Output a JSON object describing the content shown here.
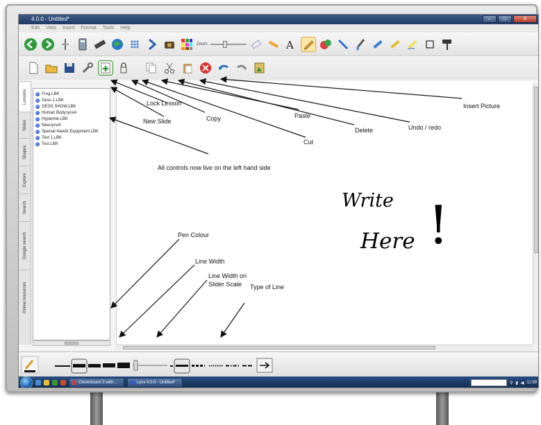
{
  "window": {
    "title": "4.0.0 - Untitled*",
    "controls": [
      "–",
      "□",
      "X"
    ]
  },
  "menu": [
    "Edit",
    "View",
    "Insert",
    "Format",
    "Tools",
    "Help"
  ],
  "toolbar_top": {
    "zoom_label": "Zoom:"
  },
  "sidebar_tabs": [
    "Lessons",
    "Slides",
    "Shapes",
    "Explore",
    "Search",
    "Google search",
    "Online resources"
  ],
  "files": [
    "Frog.LBK",
    "Gess 1.LBK",
    "GESS SHOW.LBK",
    "Human Body.lynx4",
    "Hyperlink.LBK",
    "New.lynx4",
    "Special Needs Equipment.LBK",
    "Test 1.LBK",
    "Test.LBK"
  ],
  "annotations": {
    "lock_lesson": "Lock Lesson",
    "new_slide": "New Slide",
    "copy": "Copy",
    "paste": "Paste",
    "cut": "Cut",
    "delete": "Delete",
    "undo_redo": "Undo / redo",
    "insert_picture": "Insert Picture",
    "left_controls": "All controls now live on the left hand side",
    "pen_colour": "Pen Colour",
    "line_width": "Line Width",
    "line_width_slider_1": "Line Width on",
    "line_width_slider_2": "Slider Scale",
    "type_of_line": "Type of Line"
  },
  "handwriting": {
    "line1": "Write",
    "line2": "Here",
    "mark": "!"
  },
  "taskbar": {
    "buttons": [
      "Cleverboard 3 with...",
      "Lynx 4.0.0 - Untitled*"
    ],
    "clock": "11:59"
  },
  "colors": {
    "titlebar": "#1e3a64",
    "taskbar": "#12284b",
    "canvas": "#ffffff"
  },
  "icons": {
    "toolbar_top": [
      "back-icon",
      "forward-icon",
      "pin-icon",
      "calculator-icon",
      "ruler-icon",
      "globe-icon",
      "grid-dots-icon",
      "next-arrow-icon",
      "camera-icon",
      "color-grid-icon",
      "zoom-slider",
      "eraser-icon",
      "highlighter-icon",
      "text-icon",
      "pen-icon",
      "shape-icon",
      "line-icon",
      "brush-icon",
      "marker-icon",
      "glitter-pen-icon",
      "spotlight-icon",
      "crop-icon",
      "paint-roller-icon"
    ],
    "toolbar_second": [
      "new-page-icon",
      "open-folder-icon",
      "save-icon",
      "wrench-icon",
      "new-slide-icon",
      "lock-icon",
      "copy-icon",
      "cut-icon",
      "paste-icon",
      "delete-icon",
      "undo-icon",
      "redo-icon",
      "insert-picture-icon"
    ]
  }
}
